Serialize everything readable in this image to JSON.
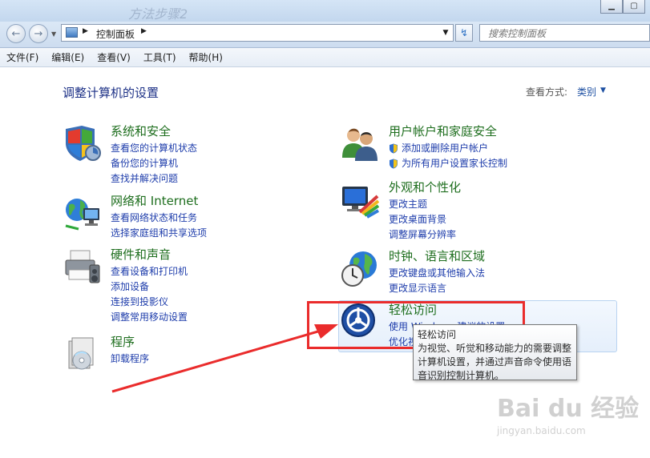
{
  "window": {
    "ghost_title": "方法步骤2"
  },
  "address": {
    "crumb": "控制面板",
    "search_placeholder": "搜索控制面板"
  },
  "menu": [
    {
      "label": "文件(F)"
    },
    {
      "label": "编辑(E)"
    },
    {
      "label": "查看(V)"
    },
    {
      "label": "工具(T)"
    },
    {
      "label": "帮助(H)"
    }
  ],
  "page": {
    "title": "调整计算机的设置",
    "view_by_label": "查看方式:",
    "view_by_value": "类别"
  },
  "categories_left": [
    {
      "title": "系统和安全",
      "icon": "shield-icon",
      "links": [
        "查看您的计算机状态",
        "备份您的计算机",
        "查找并解决问题"
      ]
    },
    {
      "title": "网络和 Internet",
      "icon": "network-icon",
      "links": [
        "查看网络状态和任务",
        "选择家庭组和共享选项"
      ]
    },
    {
      "title": "硬件和声音",
      "icon": "printer-icon",
      "links": [
        "查看设备和打印机",
        "添加设备",
        "连接到投影仪",
        "调整常用移动设置"
      ]
    },
    {
      "title": "程序",
      "icon": "programs-icon",
      "links": [
        "卸载程序"
      ]
    }
  ],
  "categories_right": [
    {
      "title": "用户帐户和家庭安全",
      "icon": "users-icon",
      "links": [
        "添加或删除用户帐户",
        "为所有用户设置家长控制"
      ]
    },
    {
      "title": "外观和个性化",
      "icon": "appearance-icon",
      "links": [
        "更改主题",
        "更改桌面背景",
        "调整屏幕分辨率"
      ]
    },
    {
      "title": "时钟、语言和区域",
      "icon": "clock-globe-icon",
      "links": [
        "更改键盘或其他输入法",
        "更改显示语言"
      ]
    },
    {
      "title": "轻松访问",
      "icon": "ease-of-access-icon",
      "links": [
        "使用 Windows 建议的设置",
        "优化视"
      ]
    }
  ],
  "tooltip": {
    "title": "轻松访问",
    "desc": "为视觉、听觉和移动能力的需要调整计算机设置，并通过声音命令使用语音识别控制计算机。"
  },
  "watermark": {
    "logo": "Bai du 经验",
    "url": "jingyan.baidu.com"
  },
  "colors": {
    "category_title": "#1e6e1e",
    "link": "#1e3dab",
    "highlight_red": "#ea2c2c"
  }
}
